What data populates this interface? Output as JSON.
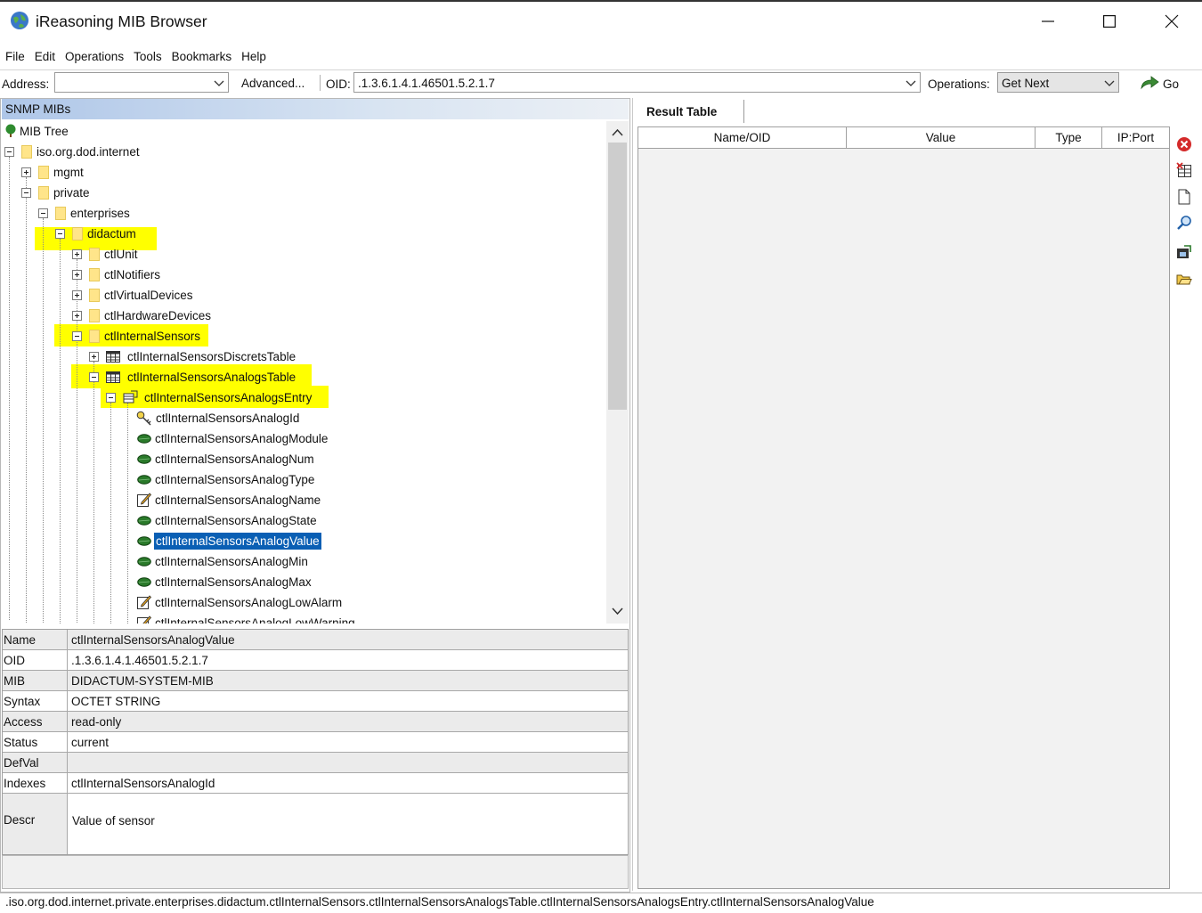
{
  "window": {
    "title": "iReasoning MIB Browser",
    "minimize": "—",
    "maximize": "☐",
    "close": "✕"
  },
  "menu": [
    "File",
    "Edit",
    "Operations",
    "Tools",
    "Bookmarks",
    "Help"
  ],
  "toolbar": {
    "address_label": "Address:",
    "address_value": "",
    "advanced_label": "Advanced...",
    "oid_label": "OID:",
    "oid_value": ".1.3.6.1.4.1.46501.5.2.1.7",
    "operations_label": "Operations:",
    "operations_value": "Get Next",
    "go_label": "Go"
  },
  "mib_panel": {
    "header": "SNMP MIBs",
    "tree": [
      {
        "label": "MIB Tree",
        "icon": "tree-icon"
      },
      {
        "label": "iso.org.dod.internet",
        "icon": "folder-icon"
      },
      {
        "label": "mgmt",
        "icon": "folder-icon"
      },
      {
        "label": "private",
        "icon": "folder-icon"
      },
      {
        "label": "enterprises",
        "icon": "folder-icon"
      },
      {
        "label": "didactum",
        "icon": "folder-icon"
      },
      {
        "label": "ctlUnit",
        "icon": "folder-icon"
      },
      {
        "label": "ctlNotifiers",
        "icon": "folder-icon"
      },
      {
        "label": "ctlVirtualDevices",
        "icon": "folder-icon"
      },
      {
        "label": "ctlHardwareDevices",
        "icon": "folder-icon"
      },
      {
        "label": "ctlInternalSensors",
        "icon": "folder-icon"
      },
      {
        "label": "ctlInternalSensorsDiscretsTable",
        "icon": "table-icon"
      },
      {
        "label": "ctlInternalSensorsAnalogsTable",
        "icon": "table-icon"
      },
      {
        "label": "ctlInternalSensorsAnalogsEntry",
        "icon": "entry-icon"
      },
      {
        "label": "ctlInternalSensorsAnalogId",
        "icon": "key-icon"
      },
      {
        "label": "ctlInternalSensorsAnalogModule",
        "icon": "leaf-icon"
      },
      {
        "label": "ctlInternalSensorsAnalogNum",
        "icon": "leaf-icon"
      },
      {
        "label": "ctlInternalSensorsAnalogType",
        "icon": "leaf-icon"
      },
      {
        "label": "ctlInternalSensorsAnalogName",
        "icon": "edit-icon"
      },
      {
        "label": "ctlInternalSensorsAnalogState",
        "icon": "leaf-icon"
      },
      {
        "label": "ctlInternalSensorsAnalogValue",
        "icon": "leaf-icon"
      },
      {
        "label": "ctlInternalSensorsAnalogMin",
        "icon": "leaf-icon"
      },
      {
        "label": "ctlInternalSensorsAnalogMax",
        "icon": "leaf-icon"
      },
      {
        "label": "ctlInternalSensorsAnalogLowAlarm",
        "icon": "edit-icon"
      },
      {
        "label": "ctlInternalSensorsAnalogLowWarning",
        "icon": "edit-icon"
      }
    ],
    "selected": "ctlInternalSensorsAnalogValue",
    "highlight_color": "#ffff00"
  },
  "properties": {
    "rows": [
      {
        "key": "Name",
        "value": "ctlInternalSensorsAnalogValue"
      },
      {
        "key": "OID",
        "value": ".1.3.6.1.4.1.46501.5.2.1.7"
      },
      {
        "key": "MIB",
        "value": "DIDACTUM-SYSTEM-MIB"
      },
      {
        "key": "Syntax",
        "value": "OCTET STRING"
      },
      {
        "key": "Access",
        "value": "read-only"
      },
      {
        "key": "Status",
        "value": "current"
      },
      {
        "key": "DefVal",
        "value": ""
      },
      {
        "key": "Indexes",
        "value": "ctlInternalSensorsAnalogId"
      },
      {
        "key": "Descr",
        "value": "Value of sensor"
      }
    ]
  },
  "result": {
    "tab_label": "Result Table",
    "columns": [
      "Name/OID",
      "Value",
      "Type",
      "IP:Port"
    ],
    "tools": [
      "delete-icon",
      "grid-delete-icon",
      "document-icon",
      "search-icon",
      "save-icon",
      "open-folder-icon"
    ]
  },
  "status_path": ".iso.org.dod.internet.private.enterprises.didactum.ctlInternalSensors.ctlInternalSensorsAnalogsTable.ctlInternalSensorsAnalogsEntry.ctlInternalSensorsAnalogValue"
}
